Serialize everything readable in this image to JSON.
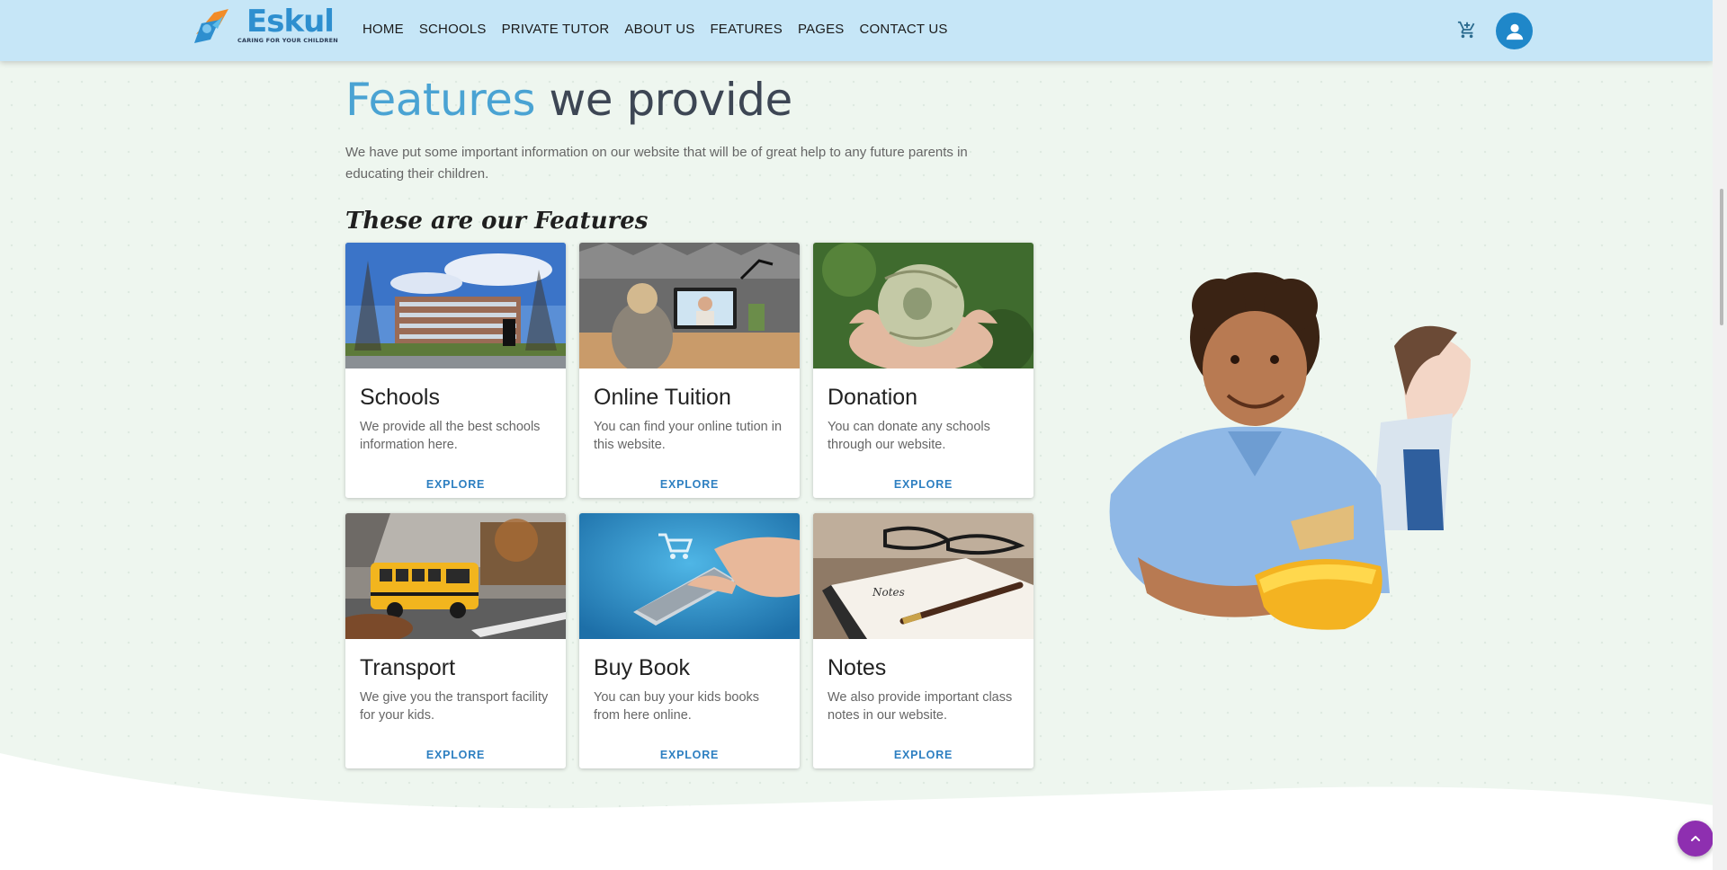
{
  "brand": {
    "name": "Eskul",
    "tagline": "CARING FOR YOUR CHILDREN"
  },
  "nav": {
    "items": [
      "HOME",
      "SCHOOLS",
      "PRIVATE TUTOR",
      "ABOUT US",
      "FEATURES",
      "PAGES",
      "CONTACT US"
    ]
  },
  "header": {
    "cart_icon": "cart-icon",
    "avatar_icon": "user-icon"
  },
  "section": {
    "title_accent": "Features",
    "title_rest": " we provide",
    "intro": "We have put some important information on our website that will be of great help to any future parents in educating their children.",
    "subtitle": "These are our Features"
  },
  "cards": [
    {
      "title": "Schools",
      "text": "We provide all the best schools information here.",
      "button": "EXPLORE"
    },
    {
      "title": "Online Tuition",
      "text": "You can find your online tution in this website.",
      "button": "EXPLORE"
    },
    {
      "title": "Donation",
      "text": "You can donate any schools through our website.",
      "button": "EXPLORE"
    },
    {
      "title": "Transport",
      "text": "We give you the transport facility for your kids.",
      "button": "EXPLORE"
    },
    {
      "title": "Buy Book",
      "text": "You can buy your kids books from here online.",
      "button": "EXPLORE"
    },
    {
      "title": "Notes",
      "text": "We also provide important class notes in our website.",
      "button": "EXPLORE"
    }
  ],
  "colors": {
    "navbar": "#c6e6f7",
    "accent": "#4aa3d3",
    "button_text": "#2d7fc1",
    "back_to_top": "#8e2fb0"
  }
}
